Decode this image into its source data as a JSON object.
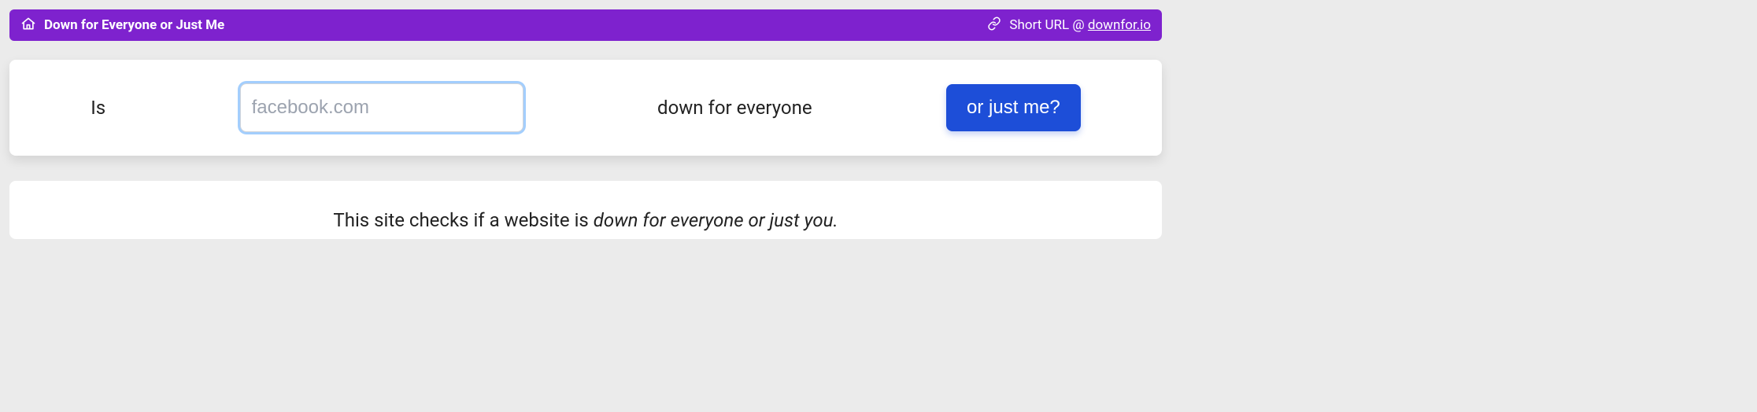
{
  "header": {
    "title": "Down for Everyone or Just Me",
    "short_url_prefix": "Short URL @ ",
    "short_url_domain": "downfor.io"
  },
  "query": {
    "prefix": "Is",
    "input_placeholder": "facebook.com",
    "middle": "down for everyone",
    "button_label": "or just me?"
  },
  "info": {
    "lead": "This site checks if a website is ",
    "emphasis": "down for everyone or just you."
  }
}
